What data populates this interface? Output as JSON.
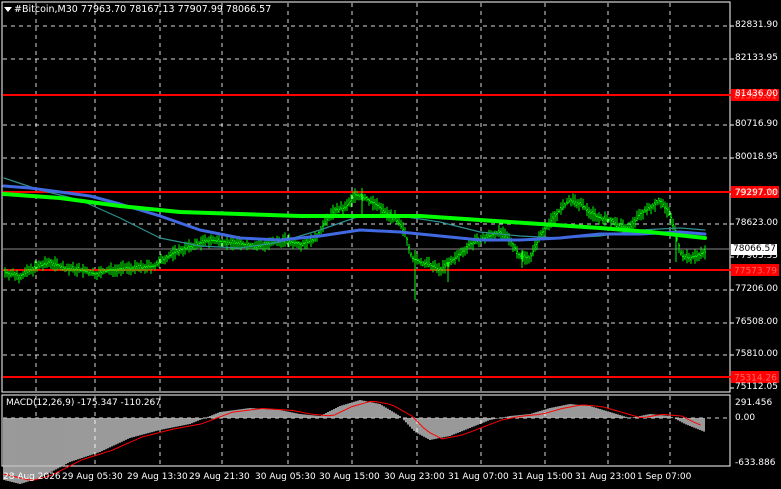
{
  "header": {
    "symbol_text": "#Bitcoin,M30",
    "ohlc_text": "77963.70 78167.13 77907.99 78066.57"
  },
  "price_axis": {
    "labels": [
      "82831.90",
      "82133.95",
      "81436.00",
      "80716.90",
      "80018.95",
      "79297.00",
      "78623.00",
      "77903.35",
      "77206.00",
      "76508.00",
      "75810.00",
      "75112.05"
    ],
    "current_price": "78066.57",
    "current_price_bg": "#ffffff",
    "current_price_fg": "#000000"
  },
  "levels": [
    {
      "label": "81383.01",
      "color": "#ff0000"
    },
    {
      "label": "79317.78",
      "color": "#ff0000"
    },
    {
      "label": "77573.79",
      "color": "#ff0000"
    },
    {
      "label": "75314.26",
      "color": "#ff0000"
    }
  ],
  "macd": {
    "label": "MACD(12,26,9) -175.347 -110.267",
    "axis_labels": [
      "291.456",
      "0.00",
      "-633.886"
    ]
  },
  "time_axis": {
    "labels": [
      "28 Aug 2026",
      "29 Aug 05:30",
      "29 Aug 13:30",
      "29 Aug 21:30",
      "30 Aug 05:30",
      "30 Aug 15:00",
      "30 Aug 23:00",
      "31 Aug 07:00",
      "31 Aug 15:00",
      "31 Aug 23:00",
      "1 Sep 07:00"
    ]
  },
  "colors": {
    "background": "#000000",
    "grid": "#ffffff",
    "candles": "#00ff00",
    "ma_fast": "#00ff00",
    "ma_mid": "#4169e1",
    "ma_slow": "#2f8f8f",
    "macd_hist": "#c0c0c0",
    "macd_signal": "#ff0000"
  }
}
